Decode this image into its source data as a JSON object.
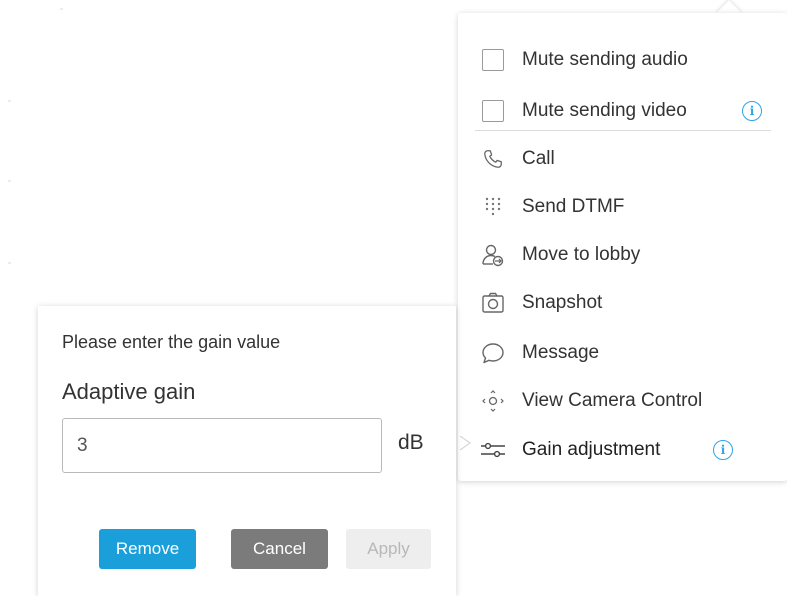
{
  "menu": {
    "items": [
      {
        "label": "Mute sending audio",
        "icon": "checkbox",
        "info": false
      },
      {
        "label": "Mute sending video",
        "icon": "checkbox",
        "info": true
      },
      {
        "label": "Call",
        "icon": "phone-icon",
        "info": false
      },
      {
        "label": "Send DTMF",
        "icon": "dialpad-icon",
        "info": false
      },
      {
        "label": "Move to lobby",
        "icon": "move-to-lobby-icon",
        "info": false
      },
      {
        "label": "Snapshot",
        "icon": "camera-icon",
        "info": false
      },
      {
        "label": "Message",
        "icon": "chat-bubble-icon",
        "info": false
      },
      {
        "label": "View Camera Control",
        "icon": "camera-control-icon",
        "info": false
      },
      {
        "label": "Gain adjustment",
        "icon": "sliders-icon",
        "info": true
      }
    ],
    "info_glyph": "i",
    "accent": "#2fa4e7"
  },
  "gain_dialog": {
    "prompt": "Please enter the gain value",
    "field_label": "Adaptive gain",
    "value": "3",
    "unit": "dB",
    "buttons": {
      "remove": "Remove",
      "cancel": "Cancel",
      "apply": "Apply"
    },
    "colors": {
      "remove": "#1a9fdb",
      "cancel": "#7b7b7b",
      "apply_disabled": "#eeeeee"
    }
  }
}
